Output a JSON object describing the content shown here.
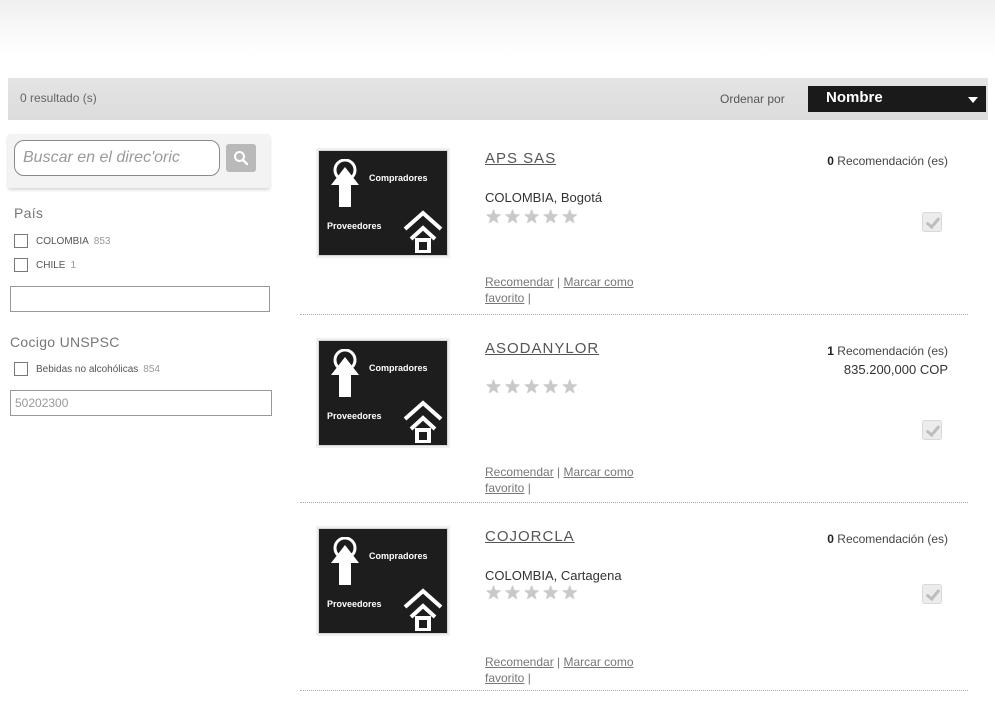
{
  "header": {
    "results_count": "0 resultado (s)",
    "sort_label": "Ordenar por",
    "sort_value": "Nombre"
  },
  "sidebar": {
    "search_placeholder": "Buscar en el direc'oric",
    "country": {
      "title": "País",
      "options": [
        {
          "label": "COLOMBIA",
          "count": "853"
        },
        {
          "label": "CHILE",
          "count": "1"
        }
      ],
      "input_value": ""
    },
    "unspsc": {
      "title": "Cocigo UNSPSC",
      "options": [
        {
          "label": "Bebidas no alcohólicas",
          "count": "854"
        }
      ],
      "input_value": "50202300"
    }
  },
  "logo": {
    "top_text": "Compradores",
    "bottom_text": "Proveedores"
  },
  "results": [
    {
      "name": "APS SAS",
      "recs_count": "0",
      "recs_label": "Recomendación (es)",
      "location": "COLOMBIA, Bogotá",
      "value": ""
    },
    {
      "name": "ASODANYLOR",
      "recs_count": "1",
      "recs_label": "Recomendación (es)",
      "location": "",
      "value": "835.200,000 COP"
    },
    {
      "name": "COJORCLA",
      "recs_count": "0",
      "recs_label": "Recomendación (es)",
      "location": "COLOMBIA, Cartagena",
      "value": ""
    }
  ],
  "actions": {
    "recommend": "Recomendar",
    "separator": "|",
    "favorite_line1": "Marcar como",
    "favorite_line2": "favorito"
  },
  "rating": {
    "stars": 5,
    "filled": 0
  }
}
